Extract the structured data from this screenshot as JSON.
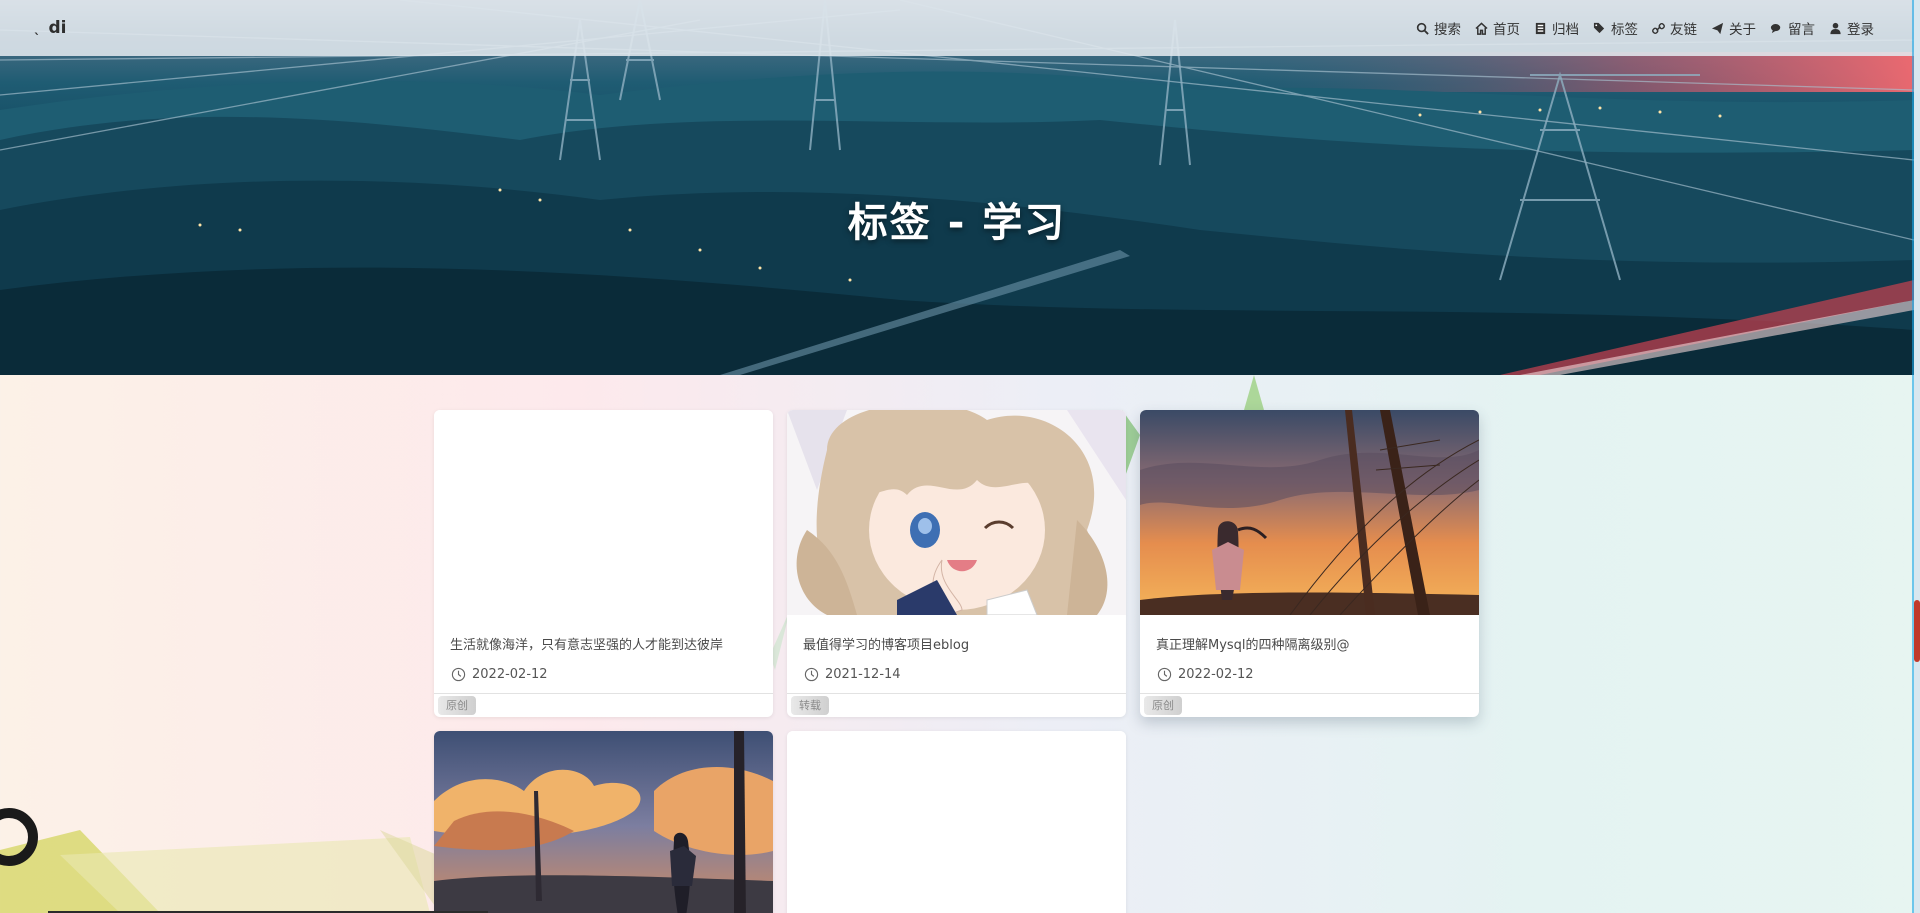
{
  "brand": {
    "mark": "ˎ",
    "name": "di"
  },
  "nav": [
    {
      "label": "搜索",
      "icon": "search-icon"
    },
    {
      "label": "首页",
      "icon": "home-icon"
    },
    {
      "label": "归档",
      "icon": "archive-icon"
    },
    {
      "label": "标签",
      "icon": "tags-icon"
    },
    {
      "label": "友链",
      "icon": "link-icon"
    },
    {
      "label": "关于",
      "icon": "paper-plane-icon"
    },
    {
      "label": "留言",
      "icon": "comments-icon"
    },
    {
      "label": "登录",
      "icon": "user-icon"
    }
  ],
  "hero": {
    "title": "标签 - 学习"
  },
  "posts": [
    {
      "title": "生活就像海洋，只有意志坚强的人才能到达彼岸",
      "date": "2022-02-12",
      "badge": "原创",
      "cover": "blank"
    },
    {
      "title": "最值得学习的博客项目eblog",
      "date": "2021-12-14",
      "badge": "转载",
      "cover": "anime-girl"
    },
    {
      "title": "真正理解Mysql的四种隔离级别@",
      "date": "2022-02-12",
      "badge": "原创",
      "cover": "sunset-powerlines"
    },
    {
      "title": "",
      "date": "",
      "badge": "",
      "cover": "clouds-sunset"
    },
    {
      "title": "",
      "date": "",
      "badge": "",
      "cover": "blank"
    }
  ],
  "colors": {
    "accent": "#c0392b",
    "nav_bg": "#e1e8ee",
    "hero_title": "#ffffff"
  }
}
